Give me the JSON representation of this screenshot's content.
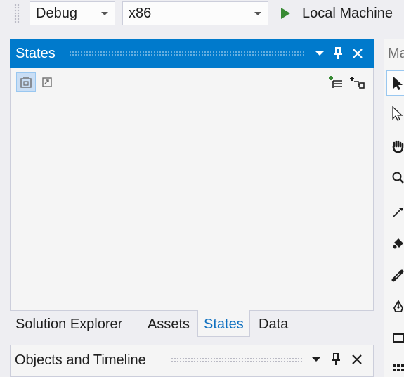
{
  "toolbar": {
    "configuration": "Debug",
    "platform": "x86",
    "run_target": "Local Machine"
  },
  "states_panel": {
    "title": "States",
    "buttons": {
      "window_position": "chevron-down-icon",
      "auto_hide": "pin-icon",
      "close": "close-icon"
    },
    "toolbar_icons": [
      "show-state-group-icon",
      "transition-preview-icon",
      "add-state-group-icon",
      "add-state-icon"
    ]
  },
  "tabs": [
    {
      "label": "Solution Explorer",
      "active": false
    },
    {
      "label": "Assets",
      "active": false
    },
    {
      "label": "States",
      "active": true
    },
    {
      "label": "Data",
      "active": false
    }
  ],
  "objects_panel": {
    "title": "Objects and Timeline"
  },
  "tools_panel": {
    "header": "Ma",
    "tools": [
      "selection-icon",
      "direct-selection-icon",
      "pan-icon",
      "zoom-icon",
      "eyedropper-icon",
      "paint-bucket-icon",
      "brush-transform-icon",
      "pen-icon",
      "rectangle-icon",
      "grid-layout-icon"
    ]
  },
  "colors": {
    "accent": "#007acc",
    "active_tab_text": "#0e70c0",
    "run_green": "#388a34",
    "background": "#eeeef2"
  }
}
